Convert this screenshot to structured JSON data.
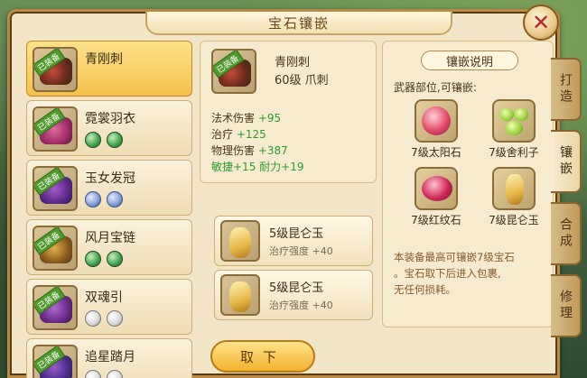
{
  "title": "宝石镶嵌",
  "items": [
    {
      "name": "青刚刺",
      "badge": "已装备",
      "selected": true,
      "gems": []
    },
    {
      "name": "霓裳羽衣",
      "badge": "已装备",
      "selected": false,
      "gems": [
        "green",
        "green"
      ]
    },
    {
      "name": "玉女发冠",
      "badge": "已装备",
      "selected": false,
      "gems": [
        "moon",
        "moon"
      ]
    },
    {
      "name": "风月宝链",
      "badge": "已装备",
      "selected": false,
      "gems": [
        "green",
        "green"
      ]
    },
    {
      "name": "双魂引",
      "badge": "已装备",
      "selected": false,
      "gems": [
        "white",
        "white"
      ]
    },
    {
      "name": "追星踏月",
      "badge": "已装备",
      "selected": false,
      "gems": [
        "white",
        "white"
      ]
    }
  ],
  "equip": {
    "name": "青刚刺",
    "level": "60级 爪刺",
    "badge": "已装备",
    "stats": [
      {
        "label": "法术伤害",
        "value": "+95",
        "style": "normal"
      },
      {
        "label": "治疗",
        "value": "+125",
        "style": "normal"
      },
      {
        "label": "物理伤害",
        "value": "+387",
        "style": "normal"
      },
      {
        "label": "敏捷+15",
        "value": "耐力+19",
        "style": "green"
      }
    ]
  },
  "socketed_gems": [
    {
      "name": "5级昆仑玉",
      "effect_label": "治疗强度",
      "effect_value": "+40"
    },
    {
      "name": "5级昆仑玉",
      "effect_label": "治疗强度",
      "effect_value": "+40"
    }
  ],
  "remove_button": "取下",
  "info": {
    "title": "镶嵌说明",
    "subtitle": "武器部位,可镶嵌:",
    "gems": [
      {
        "label": "7级太阳石",
        "icon": "sun-stone-icon"
      },
      {
        "label": "7级舍利子",
        "icon": "sarira-icon"
      },
      {
        "label": "7级红纹石",
        "icon": "red-vein-stone-icon"
      },
      {
        "label": "7级昆仑玉",
        "icon": "kunlun-jade-icon"
      }
    ],
    "note_lines": [
      "本装备最高可镶嵌7级宝石",
      "。宝石取下后进入包裹,",
      "无任何损耗。"
    ]
  },
  "tabs": [
    {
      "label": "打造",
      "active": false
    },
    {
      "label": "镶嵌",
      "active": true
    },
    {
      "label": "合成",
      "active": false
    },
    {
      "label": "修理",
      "active": false
    }
  ],
  "colors": {
    "accent": "#f2b32e",
    "stat_green": "#2e9a2e",
    "close_red": "#c0231c"
  }
}
